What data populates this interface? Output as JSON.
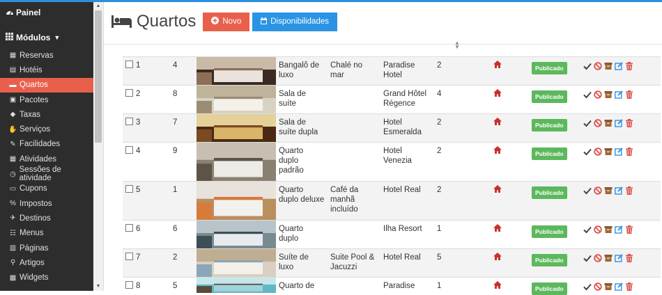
{
  "sidebar": {
    "dashboard_label": "Painel",
    "modules_label": "Módulos",
    "items": [
      {
        "label": "Reservas",
        "icon": "calendar-icon"
      },
      {
        "label": "Hotéis",
        "icon": "building-icon"
      },
      {
        "label": "Quartos",
        "icon": "bed-icon"
      },
      {
        "label": "Pacotes",
        "icon": "briefcase-icon"
      },
      {
        "label": "Taxas",
        "icon": "tags-icon"
      },
      {
        "label": "Serviços",
        "icon": "thumbs-up-icon"
      },
      {
        "label": "Facilidades",
        "icon": "wrench-icon"
      },
      {
        "label": "Atividades",
        "icon": "calendar-icon"
      },
      {
        "label": "Sessões de atividade",
        "icon": "clock-icon"
      },
      {
        "label": "Cupons",
        "icon": "ticket-icon"
      },
      {
        "label": "Impostos",
        "icon": "percent-icon"
      },
      {
        "label": "Destinos",
        "icon": "plane-icon"
      },
      {
        "label": "Menus",
        "icon": "sitemap-icon"
      },
      {
        "label": "Páginas",
        "icon": "files-icon"
      },
      {
        "label": "Artigos",
        "icon": "pin-icon"
      },
      {
        "label": "Widgets",
        "icon": "cubes-icon"
      }
    ],
    "active_item": "Quartos"
  },
  "header": {
    "title": "Quartos",
    "new_button": "Novo",
    "availability_button": "Disponibilidades"
  },
  "colors": {
    "accent": "#e8604c",
    "blue": "#2b93e3",
    "published": "#5cb85c",
    "sidebar_bg": "#2d2d2d"
  },
  "rows": [
    {
      "id": "1",
      "order": "4",
      "name": "Bangalô de luxo",
      "subtitle": "Chalé no mar",
      "hotel": "Paradise Hotel",
      "max": "2",
      "status": "Publicado"
    },
    {
      "id": "2",
      "order": "8",
      "name": "Sala de suíte",
      "subtitle": "",
      "hotel": "Grand Hôtel Régence",
      "max": "4",
      "status": "Publicado"
    },
    {
      "id": "3",
      "order": "7",
      "name": "Sala de suíte dupla",
      "subtitle": "",
      "hotel": "Hotel Esmeralda",
      "max": "2",
      "status": "Publicado"
    },
    {
      "id": "4",
      "order": "9",
      "name": "Quarto duplo padrão",
      "subtitle": "",
      "hotel": "Hotel Venezia",
      "max": "2",
      "status": "Publicado"
    },
    {
      "id": "5",
      "order": "1",
      "name": "Quarto duplo deluxe",
      "subtitle": "Café da manhã incluído",
      "hotel": "Hotel Real",
      "max": "2",
      "status": "Publicado"
    },
    {
      "id": "6",
      "order": "6",
      "name": "Quarto duplo",
      "subtitle": "",
      "hotel": "Ilha Resort",
      "max": "1",
      "status": "Publicado"
    },
    {
      "id": "7",
      "order": "2",
      "name": "Suíte de luxo",
      "subtitle": "Suite Pool & Jacuzzi",
      "hotel": "Hotel Real",
      "max": "5",
      "status": "Publicado"
    },
    {
      "id": "8",
      "order": "5",
      "name": "Quarto de",
      "subtitle": "",
      "hotel": "Paradise",
      "max": "1",
      "status": "Publicado"
    }
  ]
}
